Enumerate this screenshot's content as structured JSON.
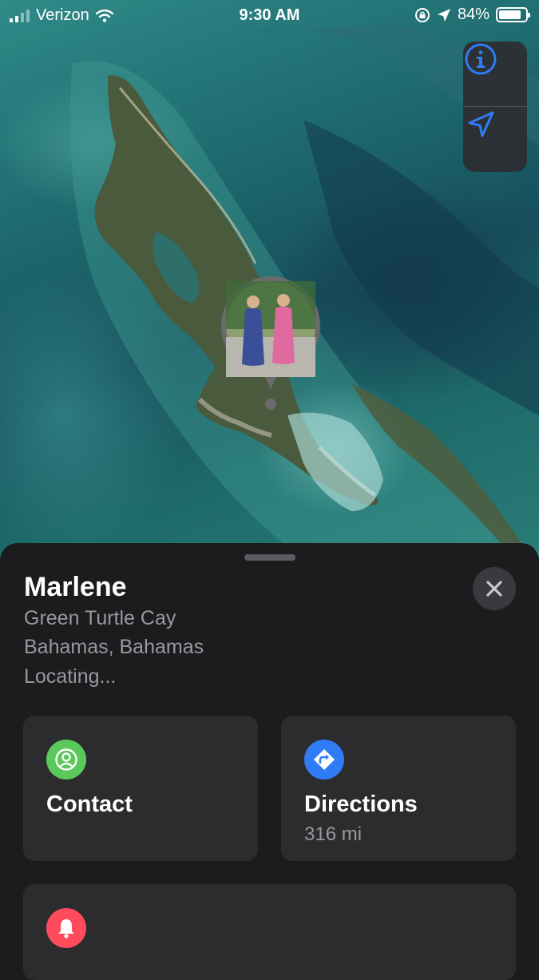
{
  "status_bar": {
    "carrier": "Verizon",
    "time": "9:30 AM",
    "battery": "84%",
    "battery_level": 0.84
  },
  "map": {
    "controls": [
      {
        "icon": "info-icon"
      },
      {
        "icon": "location-arrow-icon"
      }
    ],
    "pin": {
      "icon": "person-photo-pin"
    }
  },
  "person": {
    "name": "Marlene",
    "location_line1": "Green Turtle Cay",
    "location_line2": "Bahamas, Bahamas",
    "status": "Locating..."
  },
  "actions": {
    "contact": {
      "label": "Contact",
      "icon": "person-icon",
      "color": "#5ac85a"
    },
    "directions": {
      "label": "Directions",
      "distance": "316 mi",
      "icon": "directions-icon",
      "color": "#2f7cf6"
    },
    "notify": {
      "icon": "bell-icon",
      "color": "#ff4b5c"
    }
  },
  "colors": {
    "sheet_bg": "#1c1c1e",
    "card_bg": "#2c2c2e",
    "accent_blue": "#2f7cf6"
  }
}
